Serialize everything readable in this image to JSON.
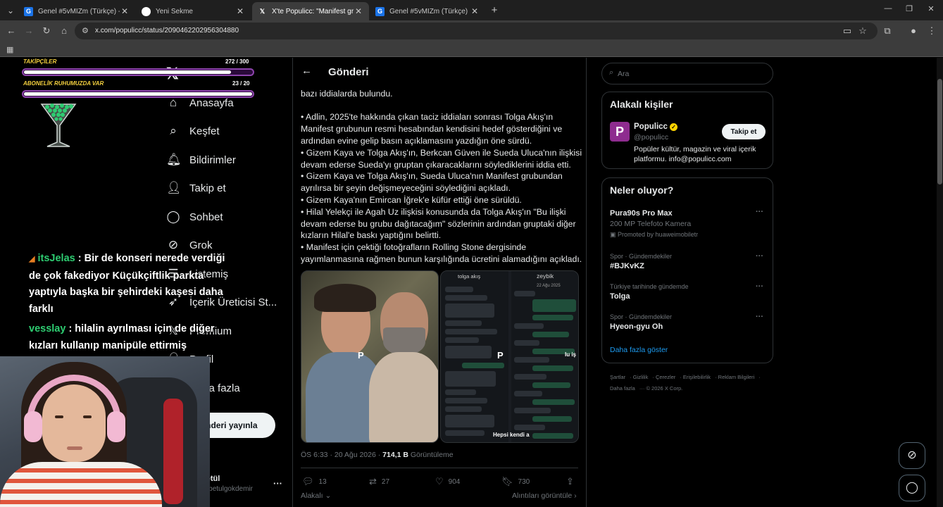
{
  "browser": {
    "tabs": [
      {
        "label": "Genel #5vMIZm (Türkçe) - Gart",
        "favicon": "google-icon",
        "active": false
      },
      {
        "label": "Yeni Sekme",
        "favicon": "chrome-icon",
        "active": false
      },
      {
        "label": "X'te Populicc: \"Manifest grubun",
        "favicon": "x-icon",
        "active": true
      },
      {
        "label": "Genel #5vMIZm (Türkçe) - Gart",
        "favicon": "google-icon",
        "active": false
      }
    ],
    "url": "x.com/populicc/status/2090462202956304880"
  },
  "overlay": {
    "followers_label": "TAKİPÇİLER",
    "followers_count": "272 / 300",
    "followers_progress": 0.907,
    "subs_label": "ABONELİK RUHUMUZDA VAR",
    "subs_count": "23 / 20",
    "subs_progress": 1.0,
    "chat": [
      {
        "prefix": "◢",
        "user": "itsJelas",
        "message": " : Bir de konseri nerede verdiği de çok fakediyor Küçükçiftlik parkta yaptıyla başka bir şehirdeki kaşesi daha farklı"
      },
      {
        "prefix": "",
        "user": "vesslay",
        "message": " : hilalin ayrılması için de diğer kızları kullanıp manipüle ettirmiş"
      }
    ]
  },
  "nav": {
    "items": [
      {
        "label": "Anasayfa",
        "icon": "home-icon"
      },
      {
        "label": "Keşfet",
        "icon": "search-icon"
      },
      {
        "label": "Bildirimler",
        "icon": "bell-icon"
      },
      {
        "label": "Takip et",
        "icon": "follow-icon"
      },
      {
        "label": "Sohbet",
        "icon": "chat-icon"
      },
      {
        "label": "Grok",
        "icon": "grok-icon"
      },
      {
        "label": "Listemiş",
        "icon": "list-icon"
      },
      {
        "label": "İçerik Üreticisi St...",
        "icon": "rocket-icon"
      },
      {
        "label": "Premium",
        "icon": "premium-icon"
      },
      {
        "label": "Profil",
        "icon": "profile-icon"
      },
      {
        "label": "Daha fazla",
        "icon": "more-icon"
      }
    ],
    "post_button": "Gönderi yayınla",
    "account_name": "betül",
    "account_handle": "@betulgokdemir"
  },
  "post": {
    "header_title": "Gönderi",
    "lines": [
      "bazı iddialarda bulundu.",
      "",
      "• Adlin, 2025'te hakkında çıkan taciz iddiaları sonrası Tolga Akış'ın",
      "Manifest grubunun resmi hesabından kendisini hedef gösterdiğini ve",
      "ardından evine gelip basın açıklamasını yazdığın öne sürdü.",
      "• Gizem Kaya ve Tolga Akış'ın, Berkcan Güven ile Sueda Uluca'nın ilişkisi",
      "devam ederse Sueda'yı gruptan çıkaracaklarını söylediklerini iddia etti.",
      "• Gizem Kaya ve Tolga Akış'ın, Sueda Uluca'nın Manifest grubundan",
      "ayrılırsa bir şeyin değişmeyeceğini söylediğini açıkladı.",
      "• Gizem Kaya'nın Emircan İğrek'e küfür ettiği öne sürüldü.",
      "• Hilal Yelekçi ile Agah Uz ilişkisi konusunda da Tolga Akış'ın \"Bu ilişki",
      "devam ederse bu grubu dağıtacağım\" sözlerinin ardından gruptaki diğer",
      "kızların Hilal'e baskı yaptığını belirtti.",
      "• Manifest için çektiği fotoğrafların Rolling Stone dergisinde",
      "yayımlanmasına rağmen bunun karşılığında ücretini alamadığını açıkladı."
    ],
    "media": {
      "watermark": "P",
      "ss_left_name": "tolga akış",
      "ss_right_name": "zeybik",
      "ss_date": "22 Ağu 2025",
      "overlay_right": "Iu iş",
      "overlay_bottom": "Hepsi kendi a"
    },
    "time": "ÖS 6:33 · 20 Ağu 2026 · ",
    "views": "714,1 B",
    "views_label": " Görüntüleme",
    "replies": "13",
    "reposts": "27",
    "likes": "904",
    "bookmarks": "730",
    "relevant": "Alakalı",
    "quotes_link": "Alıntıları görüntüle"
  },
  "sidebar": {
    "search_placeholder": "Ara",
    "relevant_title": "Alakalı kişiler",
    "person_avatar": "P",
    "person_name": "Populicc",
    "person_handle": "@populicc",
    "follow_label": "Takip et",
    "person_bio": "Popüler kültür, magazin ve viral içerik platformu. info@populicc.com",
    "trends_title": "Neler oluyor?",
    "trends": [
      {
        "meta": "",
        "name": "Pura90s Pro Max",
        "sub": "200 MP Telefoto Kamera",
        "promo": "Promoted by huaweimobiletr"
      },
      {
        "meta": "Spor · Gündemdekiler",
        "name": "#BJKvKZ",
        "sub": "",
        "promo": ""
      },
      {
        "meta": "Türkiye tarihinde gündemde",
        "name": "Tolga",
        "sub": "",
        "promo": ""
      },
      {
        "meta": "Spor · Gündemdekiler",
        "name": "Hyeon-gyu Oh",
        "sub": "",
        "promo": ""
      }
    ],
    "show_more": "Daha fazla göster",
    "footer": [
      "Şartlar",
      "Gizlilik",
      "Çerezler",
      "Erişilebilirlik",
      "Reklam Bilgileri",
      "Daha fazla",
      "© 2026 X Corp."
    ]
  }
}
